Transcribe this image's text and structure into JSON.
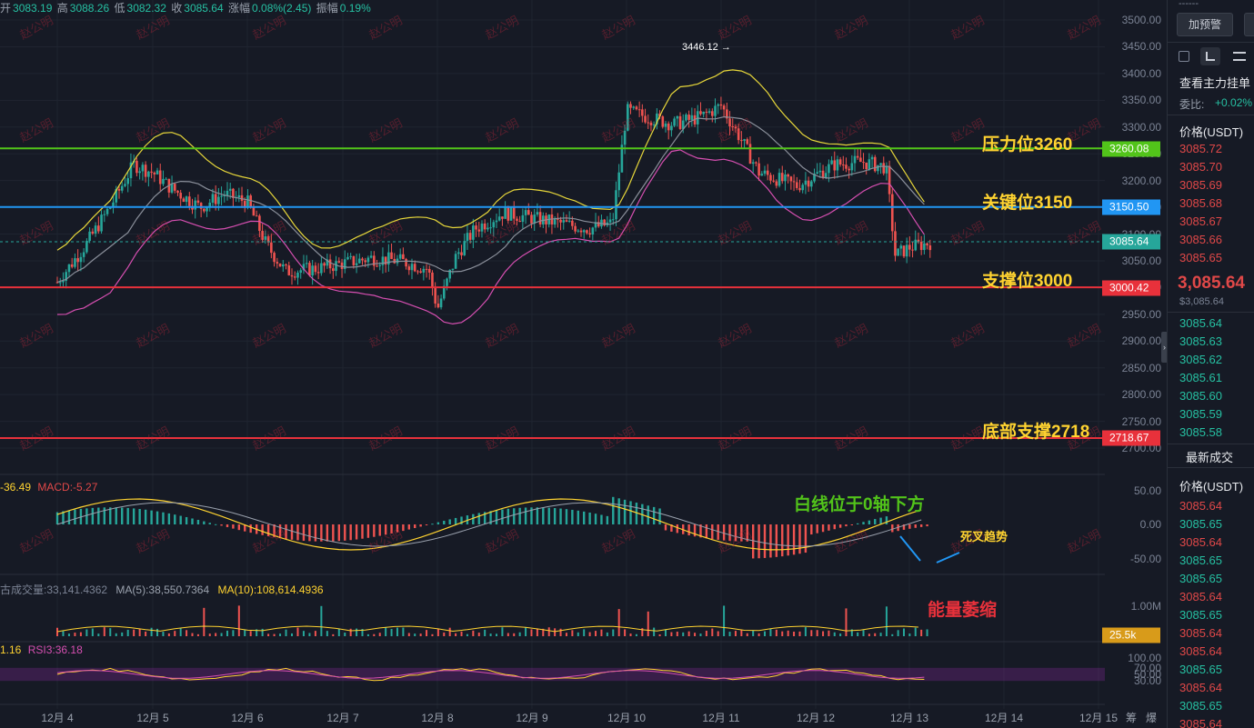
{
  "ohlc_bar": {
    "open_label": "开",
    "open": "3083.19",
    "high_label": "高",
    "high": "3088.26",
    "low_label": "低",
    "low": "3082.32",
    "close_label": "收",
    "close": "3085.64",
    "change_label": "涨幅",
    "change": "0.08%(2.45)",
    "amp_label": "振幅",
    "amp": "0.19%"
  },
  "watermark": "赵公明",
  "annotations": {
    "resistance": "压力位3260",
    "key": "关键位3150",
    "support": "支撑位3000",
    "bottom": "底部支撑2718",
    "macd_note": "白线位于0轴下方",
    "death_cross": "死叉趋势",
    "volume_note": "能量萎缩",
    "peak_label": "3446.12 →"
  },
  "price_tags": {
    "resistance": "3260.08",
    "key": "3150.50",
    "current": "3085.64",
    "support": "3000.42",
    "bottom": "2718.67",
    "volume": "25.5k"
  },
  "macd_legend": {
    "a": "-36.49",
    "b": "MACD:-5.27"
  },
  "volume_legend": {
    "a": "古成交量:33,141.4362",
    "b": "MA(5):38,550.7364",
    "c": "MA(10):108,614.4936"
  },
  "rsi_legend": {
    "a": "1.16",
    "b": "RSI3:36.18"
  },
  "sidebar": {
    "top_dashes": "------",
    "alert_button": "加预警",
    "orderbook_title": "查看主力挂单",
    "ratio_label": "委比:",
    "ratio_value": "+0.02%",
    "price_header": "价格(USDT)",
    "sell_prices": [
      "3085.72",
      "3085.70",
      "3085.69",
      "3085.68",
      "3085.67",
      "3085.66",
      "3085.65"
    ],
    "last_price": "3,085.64",
    "last_price_sub": "$3,085.64",
    "buy_prices": [
      "3085.64",
      "3085.63",
      "3085.62",
      "3085.61",
      "3085.60",
      "3085.59",
      "3085.58"
    ],
    "trades_title": "最新成交",
    "trades_header": "价格(USDT)",
    "trades": [
      {
        "p": "3085.64",
        "side": "sell"
      },
      {
        "p": "3085.65",
        "side": "buy"
      },
      {
        "p": "3085.64",
        "side": "sell"
      },
      {
        "p": "3085.65",
        "side": "buy"
      },
      {
        "p": "3085.65",
        "side": "buy"
      },
      {
        "p": "3085.64",
        "side": "sell"
      },
      {
        "p": "3085.65",
        "side": "buy"
      },
      {
        "p": "3085.64",
        "side": "sell"
      },
      {
        "p": "3085.64",
        "side": "sell"
      },
      {
        "p": "3085.65",
        "side": "buy"
      },
      {
        "p": "3085.64",
        "side": "sell"
      },
      {
        "p": "3085.65",
        "side": "buy"
      },
      {
        "p": "3085.64",
        "side": "sell"
      }
    ]
  },
  "bottom_right": {
    "a": "筹",
    "b": "爆"
  },
  "colors": {
    "up": "#26a69a",
    "down": "#ef5350",
    "resistance": "#52c41a",
    "key": "#2196f3",
    "support": "#e8313b",
    "boll_upper": "#e6d63a",
    "boll_lower": "#d64fb1",
    "boll_mid": "#8a8f9a"
  },
  "chart_data": {
    "type": "candlestick",
    "x_ticks": [
      "12月 4",
      "12月 5",
      "12月 6",
      "12月 7",
      "12月 8",
      "12月 9",
      "12月 10",
      "12月 11",
      "12月 12",
      "12月 13",
      "12月 14",
      "12月 15"
    ],
    "y_ticks": [
      3500,
      3450,
      3400,
      3350,
      3300,
      3250,
      3200,
      3150,
      3100,
      3050,
      3000,
      2950,
      2900,
      2850,
      2800,
      2750,
      2700
    ],
    "ylim": [
      2690,
      3520
    ],
    "levels": [
      {
        "name": "压力位3260",
        "value": 3260.08
      },
      {
        "name": "关键位3150",
        "value": 3150.5
      },
      {
        "name": "支撑位3000",
        "value": 3000.42
      },
      {
        "name": "底部支撑2718",
        "value": 2718.67
      }
    ],
    "current_price": 3085.64,
    "price_path": [
      [
        0,
        3010
      ],
      [
        0.3,
        3080
      ],
      [
        0.55,
        3150
      ],
      [
        0.8,
        3230
      ],
      [
        1.0,
        3215
      ],
      [
        1.2,
        3185
      ],
      [
        1.5,
        3150
      ],
      [
        1.75,
        3175
      ],
      [
        2.0,
        3160
      ],
      [
        2.2,
        3080
      ],
      [
        2.4,
        3030
      ],
      [
        2.7,
        3035
      ],
      [
        3.0,
        3045
      ],
      [
        3.3,
        3055
      ],
      [
        3.6,
        3050
      ],
      [
        3.9,
        3035
      ],
      [
        4.0,
        2960
      ],
      [
        4.2,
        3060
      ],
      [
        4.4,
        3110
      ],
      [
        4.7,
        3140
      ],
      [
        5.0,
        3130
      ],
      [
        5.3,
        3120
      ],
      [
        5.6,
        3110
      ],
      [
        5.85,
        3120
      ],
      [
        6.0,
        3330
      ],
      [
        6.2,
        3320
      ],
      [
        6.5,
        3305
      ],
      [
        6.8,
        3320
      ],
      [
        7.0,
        3340
      ],
      [
        7.2,
        3280
      ],
      [
        7.4,
        3215
      ],
      [
        7.8,
        3190
      ],
      [
        8.0,
        3210
      ],
      [
        8.2,
        3230
      ],
      [
        8.5,
        3235
      ],
      [
        8.75,
        3225
      ],
      [
        8.85,
        3060
      ],
      [
        9.0,
        3075
      ],
      [
        9.25,
        3085
      ]
    ],
    "macd_ticks": [
      50.0,
      0.0,
      -50.0
    ],
    "volume_ticks": [
      "1.00M"
    ],
    "rsi_ticks": [
      100.0,
      70.0,
      50.0,
      30.0
    ]
  }
}
